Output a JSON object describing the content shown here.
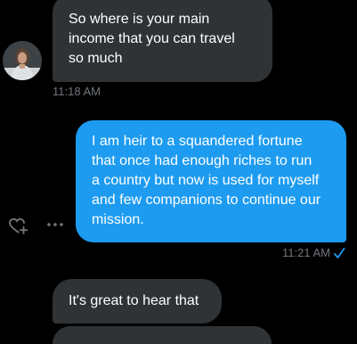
{
  "messages": [
    {
      "direction": "received",
      "text": "So where is your main\nincome that you can travel\nso much",
      "time": "11:18 AM"
    },
    {
      "direction": "sent",
      "text": "I am heir to a squandered fortune\nthat once had enough riches to run\na country but now is used for myself\nand few companions to continue our\nmission.",
      "time": "11:21 AM"
    },
    {
      "direction": "received",
      "text": "It's great to hear that"
    }
  ],
  "icons": {
    "avatar": "avatar",
    "react": "add-reaction-icon",
    "more": "more-options-icon",
    "read": "checkmark-icon"
  },
  "colors": {
    "background": "#000000",
    "received_bubble": "#2f3336",
    "sent_bubble": "#1d9bf0",
    "timestamp": "#71767b"
  }
}
